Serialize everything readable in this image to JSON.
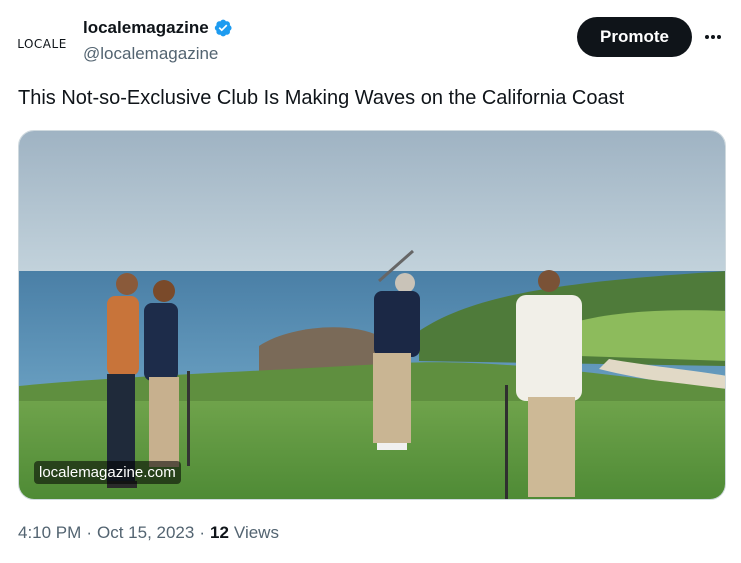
{
  "account": {
    "avatar_text": "LOCALE",
    "display_name": "localemagazine",
    "handle": "@localemagazine",
    "verified": true
  },
  "actions": {
    "promote_label": "Promote",
    "more_icon": "more-horizontal-icon"
  },
  "tweet": {
    "text": "This Not-so-Exclusive Club Is Making Waves on the California Coast",
    "media_watermark": "localemagazine.com"
  },
  "meta": {
    "time": "4:10 PM",
    "dot1": "·",
    "date": "Oct 15, 2023",
    "dot2": "·",
    "views_count": "12",
    "views_label": "Views"
  },
  "colors": {
    "verified_blue": "#1d9bf0",
    "text_primary": "#0f1419",
    "text_secondary": "#536471",
    "button_dark": "#0f1419"
  }
}
